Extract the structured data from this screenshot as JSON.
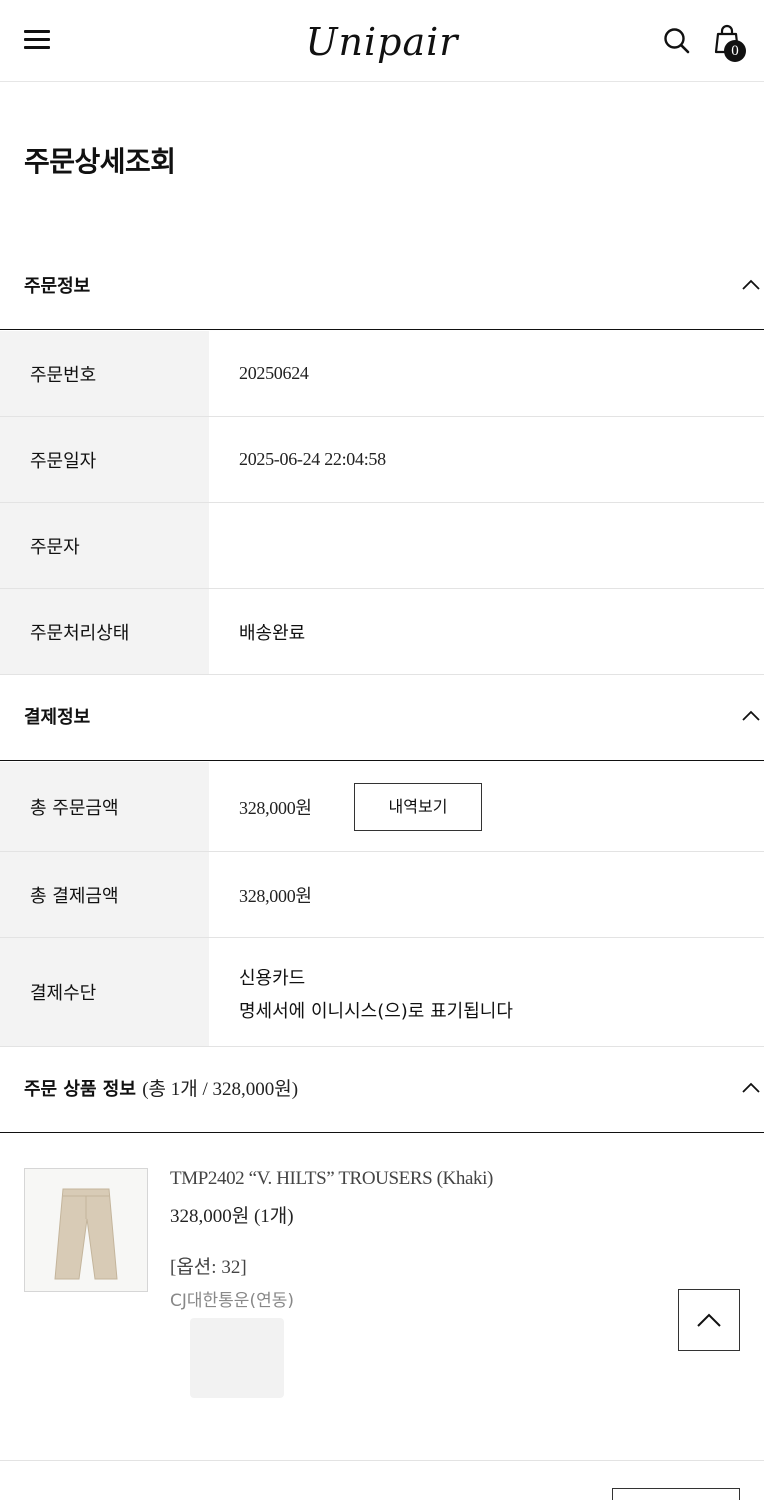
{
  "header": {
    "logo": "Unipair",
    "cart_count": "0"
  },
  "page_title": "주문상세조회",
  "order_info": {
    "title": "주문정보",
    "rows": [
      {
        "label": "주문번호",
        "value": "20250624"
      },
      {
        "label": "주문일자",
        "value": "2025-06-24 22:04:58"
      },
      {
        "label": "주문자",
        "value": ""
      },
      {
        "label": "주문처리상태",
        "value": "배송완료"
      }
    ]
  },
  "payment_info": {
    "title": "결제정보",
    "total_order_label": "총 주문금액",
    "total_order_value": "328,000원",
    "details_button": "내역보기",
    "total_paid_label": "총 결제금액",
    "total_paid_value": "328,000원",
    "method_label": "결제수단",
    "method_value": "신용카드",
    "method_note": "명세서에 이니시스(으)로 표기됩니다"
  },
  "products": {
    "title": "주문 상품 정보",
    "summary": "(총 1개 / 328,000원)",
    "items": [
      {
        "name": "TMP2402 “V. HILTS” TROUSERS (Khaki)",
        "price": "328,000원 (1개)",
        "option": "[옵션: 32]",
        "courier": "CJ대한통운(연동)"
      }
    ]
  },
  "icons": {
    "menu": "hamburger-menu-icon",
    "search": "search-icon",
    "cart": "shopping-bag-icon",
    "collapse": "chevron-up-icon",
    "scroll_top": "chevron-up-icon"
  }
}
